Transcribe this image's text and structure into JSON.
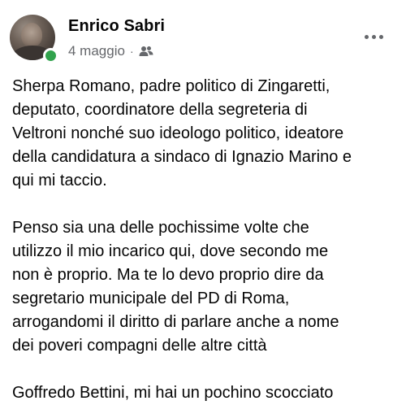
{
  "post": {
    "author": "Enrico Sabri",
    "date": "4 maggio",
    "separator": "·",
    "audience_icon": "friends-icon",
    "more_icon": "more-horizontal-icon",
    "online_color": "#31a24c",
    "paragraphs": [
      "Sherpa Romano, padre politico di Zingaretti,\ndeputato, coordinatore della segreteria di\nVeltroni nonché suo ideologo politico, ideatore\ndella candidatura a sindaco di Ignazio Marino e\nqui mi taccio.",
      "Penso sia una delle pochissime volte che\nutilizzo il mio incarico qui, dove secondo me\nnon è proprio. Ma te lo devo proprio dire da\nsegretario municipale del PD di Roma,\narrogandomi il diritto di parlare anche a nome\ndei poveri compagni delle altre città",
      "Goffredo Bettini, mi hai un pochino scocciato"
    ]
  }
}
